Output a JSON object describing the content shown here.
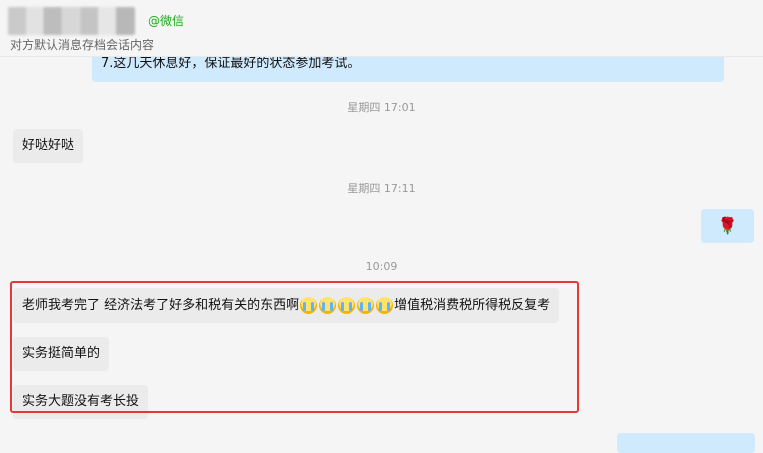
{
  "header": {
    "wechat_tag": "@微信",
    "subtitle": "对方默认消息存档会话内容"
  },
  "messages": {
    "top_outgoing": "7.这几天休息好，保证最好的状态参加考试。",
    "time1": "星期四 17:01",
    "msg1": "好哒好哒",
    "time2": "星期四 17:11",
    "rose_emoji": "🌹",
    "time3": "10:09",
    "long_msg_part1": "老师我考完了 经济法考了好多和税有关的东西啊",
    "long_msg_part2": "增值税消费税所得税反复考",
    "msg3": "实务挺简单的",
    "msg4": "实务大题没有考长投"
  },
  "icons": {
    "crying": "crying-face-emoji",
    "rose": "rose-emoji"
  },
  "colors": {
    "incoming_bubble": "#ebebeb",
    "outgoing_bubble": "#cfe9fd",
    "highlight_border": "#e53935",
    "wechat_green": "#1aad19"
  }
}
